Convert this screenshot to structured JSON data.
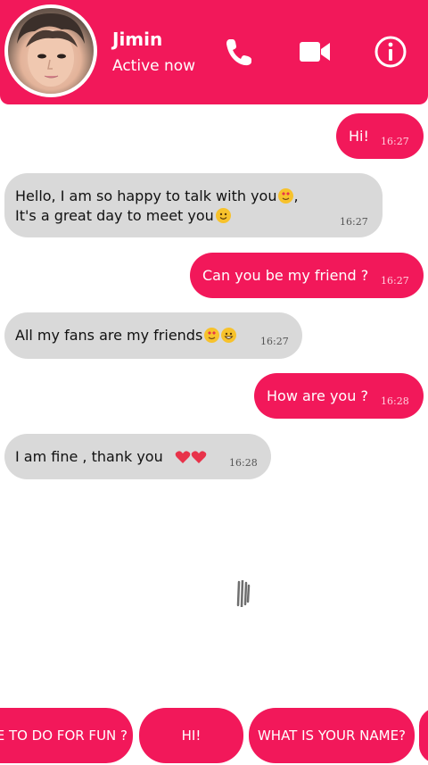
{
  "header": {
    "name": "Jimin",
    "status": "Active now",
    "icons": [
      "phone-icon",
      "video-camera-icon",
      "info-icon"
    ]
  },
  "messages": [
    {
      "side": "out",
      "text": "Hi!",
      "time": "16:27"
    },
    {
      "side": "in",
      "line1": "Hello, I am so happy to talk with you",
      "line2": "It's a great day to meet you",
      "time": "16:27"
    },
    {
      "side": "out",
      "text": "Can you be my friend ?",
      "time": "16:27"
    },
    {
      "side": "in",
      "text": "All my fans are my friends",
      "time": "16:27"
    },
    {
      "side": "out",
      "text": "How are you ?",
      "time": "16:28"
    },
    {
      "side": "in",
      "text": "I am fine , thank you",
      "time": "16:28"
    }
  ],
  "quick_replies": [
    "E TO DO FOR FUN ?",
    "HI!",
    "WHAT IS YOUR NAME?"
  ],
  "colors": {
    "accent": "#f2185a",
    "incoming_bubble": "#d9d9d9"
  }
}
